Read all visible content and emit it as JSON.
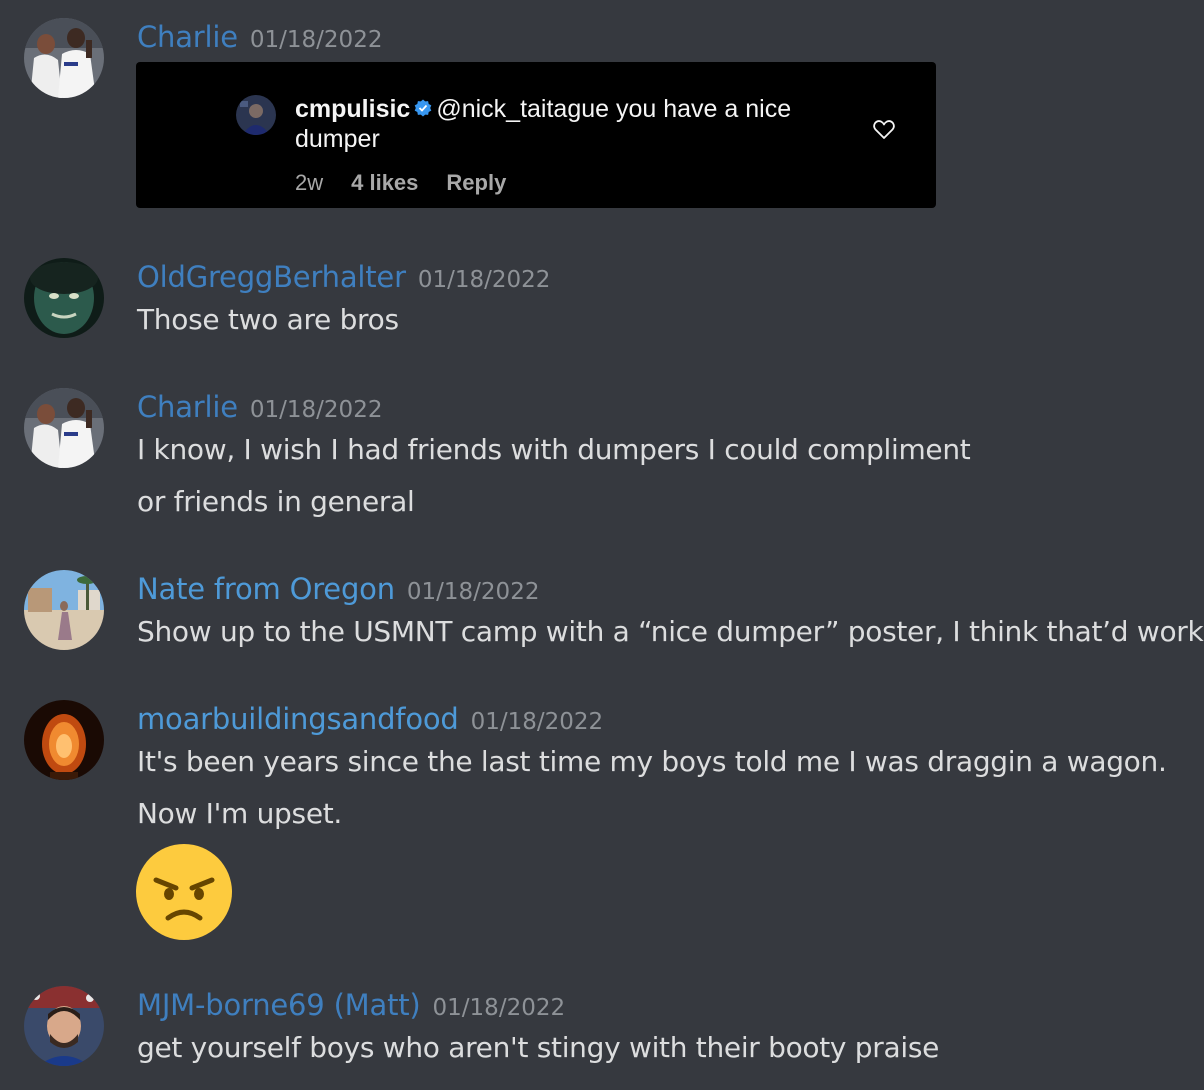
{
  "colors": {
    "background": "#36393f",
    "username": "#3f7fbf",
    "timestamp": "#8e9297",
    "message_text": "#dcddde",
    "embed_background": "#000000",
    "verified_badge": "#3897f0"
  },
  "messages": [
    {
      "author": "Charlie",
      "timestamp": "01/18/2022",
      "avatar_icon": "soccer-players-avatar",
      "embed": {
        "type": "instagram-comment",
        "avatar_icon": "instagram-user-avatar",
        "username": "cmpulisic",
        "verified_icon": "verified-badge-icon",
        "comment_line1": "@nick_taitague you have a nice",
        "comment_line2": "dumper",
        "age": "2w",
        "likes": "4 likes",
        "reply_label": "Reply",
        "like_icon": "heart-icon"
      }
    },
    {
      "author": "OldGreggBerhalter",
      "timestamp": "01/18/2022",
      "avatar_icon": "old-gregg-avatar",
      "lines": [
        "Those two are bros"
      ]
    },
    {
      "author": "Charlie",
      "timestamp": "01/18/2022",
      "avatar_icon": "soccer-players-avatar",
      "lines": [
        "I know, I wish I had friends with dumpers I could compliment",
        "or friends in general"
      ]
    },
    {
      "author": "Nate from Oregon",
      "timestamp": "01/18/2022",
      "avatar_icon": "beach-avatar",
      "lines": [
        "Show up to the USMNT camp with a “nice dumper” poster, I think that’d work"
      ]
    },
    {
      "author": "moarbuildingsandfood",
      "timestamp": "01/18/2022",
      "avatar_icon": "salt-lamp-avatar",
      "lines": [
        "It's been years since the last time my boys told me I was draggin a wagon.",
        "Now I'm upset."
      ],
      "emoji": "angry-face-emoji"
    },
    {
      "author": "MJM-borne69 (Matt)",
      "timestamp": "01/18/2022",
      "avatar_icon": "matt-avatar",
      "lines": [
        "get yourself boys who aren't stingy with their booty praise"
      ]
    }
  ]
}
